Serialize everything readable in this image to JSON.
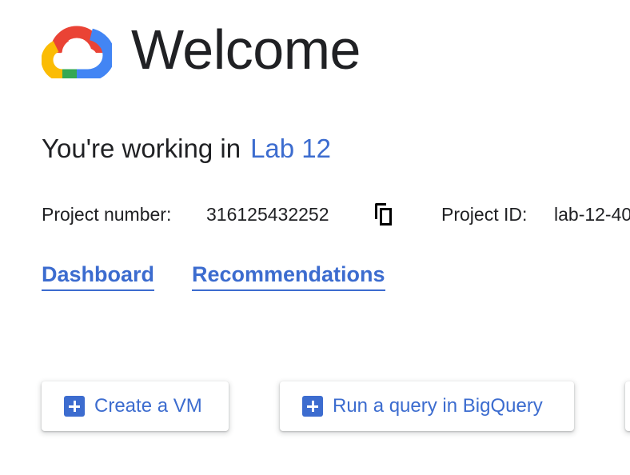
{
  "header": {
    "title": "Welcome",
    "logo": "google-cloud-logo"
  },
  "project": {
    "working_prefix": "You're working in",
    "name": "Lab 12",
    "number_label": "Project number:",
    "number_value": "316125432252",
    "id_label": "Project ID:",
    "id_value": "lab-12-40"
  },
  "links": {
    "dashboard": "Dashboard",
    "recommendations": "Recommendations"
  },
  "actions": [
    {
      "label": "Create a VM",
      "icon": "plus-icon"
    },
    {
      "label": "Run a query in BigQuery",
      "icon": "plus-icon"
    }
  ],
  "colors": {
    "accent": "#3c6ccf",
    "text": "#202124",
    "logo_red": "#ea4335",
    "logo_blue": "#4285f4",
    "logo_yellow": "#fbbc04",
    "logo_green": "#34a853"
  }
}
